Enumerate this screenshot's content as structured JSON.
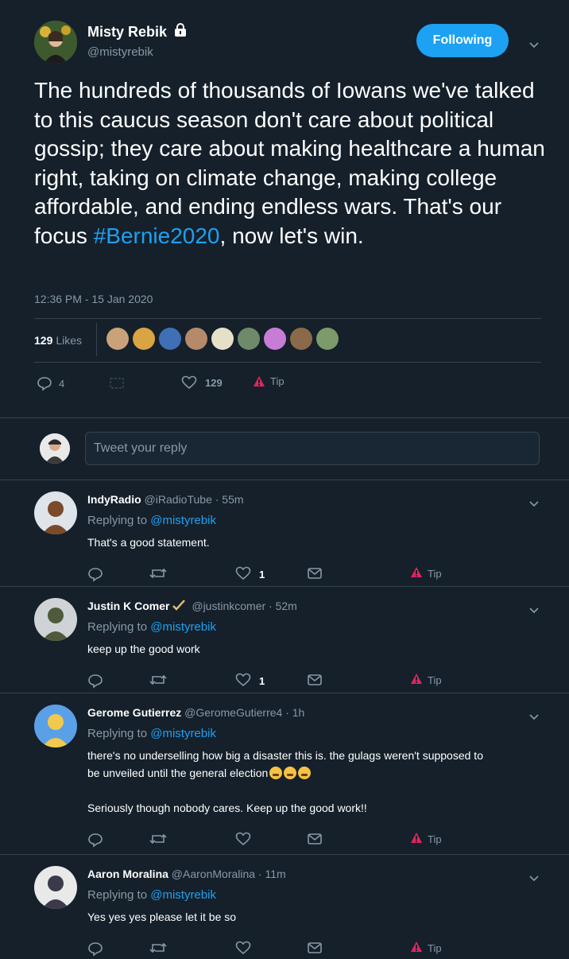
{
  "main": {
    "author_name": "Misty Rebik",
    "author_handle": "@mistyrebik",
    "follow_label": "Following",
    "text_before_hashtag": "The hundreds of thousands of Iowans we've talked to this caucus season don't care about political gossip; they care about making healthcare a human right, taking on climate change, making college affordable, and ending endless wars. That's our focus ",
    "hashtag": "#Bernie2020",
    "text_after_hashtag": ", now let's win.",
    "timestamp": "12:36 PM - 15 Jan 2020",
    "likes_count": "129",
    "likes_label": "Likes",
    "likers": [
      "#c9a27a",
      "#d9a441",
      "#3f6fb5",
      "#b58a6a",
      "#e5e0c8",
      "#6f8a6a",
      "#c77dd6",
      "#8a6a4a",
      "#7d9a6a"
    ],
    "reply_count": "4",
    "like_count": "129",
    "tip_label": "Tip"
  },
  "compose": {
    "placeholder": "Tweet your reply"
  },
  "replies": [
    {
      "name": "IndyRadio",
      "handle": "@iRadioTube",
      "time": "· 55m",
      "replying_label": "Replying to",
      "replying_to": "@mistyrebik",
      "lines": [
        "That's a good statement."
      ],
      "likes": "1",
      "tip": "Tip"
    },
    {
      "name": "Justin K Comer",
      "handle": "@justinkcomer",
      "time": "· 52m",
      "replying_label": "Replying to",
      "replying_to": "@mistyrebik",
      "lines": [
        "keep up the good work"
      ],
      "likes": "1",
      "tip": "Tip"
    },
    {
      "name": "Gerome Gutierrez",
      "handle": "@GeromeGutierre4",
      "time": "· 1h",
      "replying_label": "Replying to",
      "replying_to": "@mistyrebik",
      "lines": [
        "there's no underselling how big a disaster this is. the gulags weren't supposed to",
        "be unveiled until the general election",
        "",
        "Seriously though nobody cares. Keep up the good work!!"
      ],
      "likes": "",
      "tip": "Tip"
    },
    {
      "name": "Aaron Moralina",
      "handle": "@AaronMoralina",
      "time": "· 11m",
      "replying_label": "Replying to",
      "replying_to": "@mistyrebik",
      "lines": [
        "Yes yes yes please let it be so"
      ],
      "likes": "",
      "tip": "Tip"
    }
  ],
  "colors": {
    "background": "#15202b",
    "accent": "#1da1f2",
    "muted": "#8899a6",
    "divider": "#38444d",
    "tip_red": "#e0245e"
  }
}
